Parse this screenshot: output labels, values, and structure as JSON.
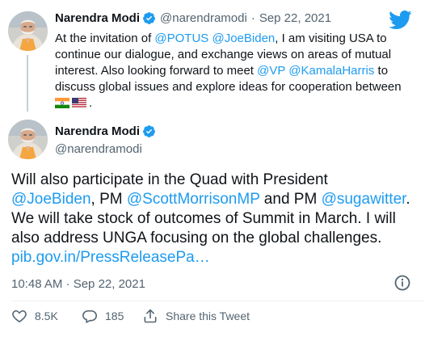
{
  "brand": {
    "icon": "twitter-bird-icon",
    "color": "#1d9bf0"
  },
  "quoted_tweet": {
    "name": "Narendra Modi",
    "handle": "@narendramodi",
    "date_sep": "·",
    "date": "Sep 22, 2021",
    "text": {
      "p1": "At the invitation of ",
      "m1": "@POTUS",
      "sp1": " ",
      "m2": "@JoeBiden",
      "p2": ", I am visiting USA to continue our dialogue, and exchange views on areas of mutual interest. Also looking forward to meet ",
      "m3": "@VP",
      "sp2": " ",
      "m4": "@KamalaHarris",
      "p3": " to discuss global issues and explore ideas for cooperation between ",
      "p4": "."
    },
    "flags": [
      "india-flag-emoji",
      "usa-flag-emoji"
    ]
  },
  "main_tweet": {
    "name": "Narendra Modi",
    "handle": "@narendramodi",
    "text": {
      "p1": "Will also participate in the Quad with President ",
      "m1": "@JoeBiden",
      "p2": ", PM ",
      "m2": "@ScottMorrisonMP",
      "p3": " and PM ",
      "m3": "@sugawitter",
      "p4": ". We will take stock of outcomes of Summit in March. I will also address UNGA focusing on the global challenges. ",
      "link": "pib.gov.in/PressReleasePa…"
    },
    "timestamp": "10:48 AM · Sep 22, 2021"
  },
  "actions": {
    "like_count": "8.5K",
    "reply_count": "185",
    "share_label": "Share this Tweet"
  },
  "colors": {
    "text": "#0f1419",
    "muted": "#536471",
    "link": "#1d9bf0",
    "verified": "#1d9bf0",
    "thread_line": "#c4cfd6"
  }
}
